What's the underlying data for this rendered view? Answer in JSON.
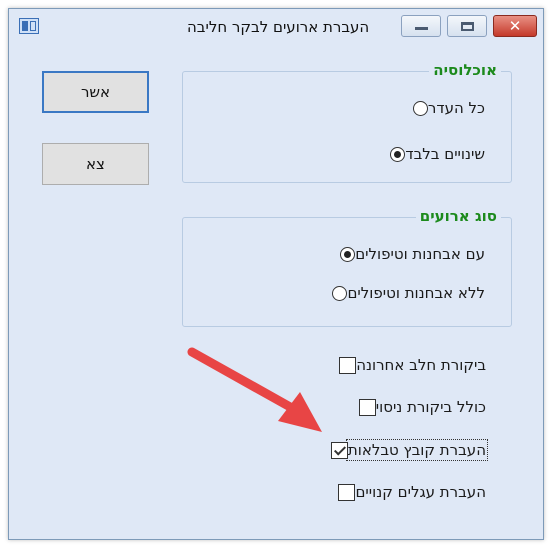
{
  "window": {
    "title": "העברת ארועים לבקר חליבה"
  },
  "title_buttons": {
    "close_glyph": "✕"
  },
  "population": {
    "legend": "אוכלוסיה",
    "options": [
      {
        "label": "כל העדר",
        "checked": false
      },
      {
        "label": "שינויים בלבד",
        "checked": true
      }
    ]
  },
  "event_type": {
    "legend": "סוג ארועים",
    "options": [
      {
        "label": "עם אבחנות וטיפולים",
        "checked": true
      },
      {
        "label": "ללא אבחנות וטיפולים",
        "checked": false
      }
    ]
  },
  "checks": [
    {
      "label": "ביקורת חלב אחרונה",
      "checked": false
    },
    {
      "label": "כולל ביקורת ניסוי",
      "checked": false
    },
    {
      "label": "העברת קובץ טבלאות",
      "checked": true
    },
    {
      "label": "העברת עגלים קנויים",
      "checked": false
    }
  ],
  "buttons": {
    "ok": "אשר",
    "exit": "צא"
  },
  "annotation": {
    "arrow_color": "#e84545"
  }
}
